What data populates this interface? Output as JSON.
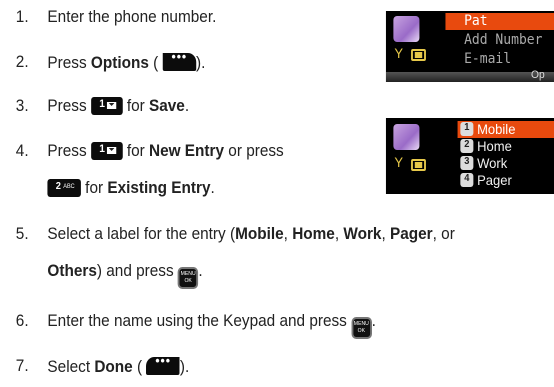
{
  "steps": [
    {
      "num": "1.",
      "text": "Enter the phone number."
    },
    {
      "num": "2.",
      "pre": "Press ",
      "bold": "Options",
      "post_open": " (",
      "post_close": ")."
    },
    {
      "num": "3.",
      "pre": "Press ",
      "mid": " for ",
      "bold": "Save",
      "end": "."
    },
    {
      "num": "4.",
      "pre": "Press ",
      "mid": " for ",
      "bold": "New Entry",
      "tail": " or press",
      "line2_mid": " for ",
      "line2_bold": "Existing Entry",
      "line2_end": "."
    },
    {
      "num": "5.",
      "line1_a": "Select a label for the entry (",
      "b1": "Mobile",
      "c1": ", ",
      "b2": "Home",
      "c2": ", ",
      "b3": "Work",
      "c3": ", ",
      "b4": "Pager",
      "c4": ", or",
      "b5": "Others",
      "line2_mid": ") and press ",
      "line2_end": "."
    },
    {
      "num": "6.",
      "text": "Enter the name using the Keypad and press ",
      "end": "."
    },
    {
      "num": "7.",
      "pre": "Select ",
      "bold": "Done",
      "open": " (",
      "close": ")."
    }
  ],
  "keys": {
    "one": {
      "digit": "1"
    },
    "two": {
      "digit": "2",
      "letters": "ABC"
    },
    "menu_ok": {
      "top": "MENU",
      "bottom": "OK"
    },
    "soft_dots": "•••"
  },
  "screen1": {
    "rows": [
      "Pat",
      "Add Number",
      "E-mail"
    ],
    "softkey": "Op"
  },
  "screen2": {
    "rows": [
      {
        "index": "1",
        "label": "Mobile"
      },
      {
        "index": "2",
        "label": "Home"
      },
      {
        "index": "3",
        "label": "Work"
      },
      {
        "index": "4",
        "label": "Pager"
      }
    ]
  },
  "colors": {
    "highlight": "#e84a0e",
    "icon_yellow": "#e6c84a"
  }
}
